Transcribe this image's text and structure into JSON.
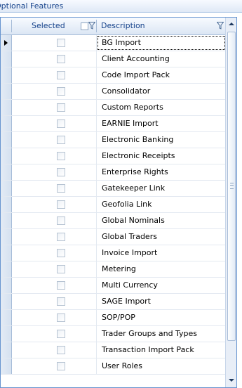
{
  "panel": {
    "title": "Optional Features"
  },
  "grid": {
    "columns": {
      "selected": "Selected",
      "description": "Description"
    },
    "current_row": 0,
    "rows": [
      {
        "description": "BG Import",
        "selected": false
      },
      {
        "description": "Client Accounting",
        "selected": false
      },
      {
        "description": "Code Import Pack",
        "selected": false
      },
      {
        "description": "Consolidator",
        "selected": false
      },
      {
        "description": "Custom Reports",
        "selected": false
      },
      {
        "description": "EARNIE Import",
        "selected": false
      },
      {
        "description": "Electronic Banking",
        "selected": false
      },
      {
        "description": "Electronic Receipts",
        "selected": false
      },
      {
        "description": "Enterprise Rights",
        "selected": false
      },
      {
        "description": "Gatekeeper Link",
        "selected": false
      },
      {
        "description": "Geofolia Link",
        "selected": false
      },
      {
        "description": "Global Nominals",
        "selected": false
      },
      {
        "description": "Global Traders",
        "selected": false
      },
      {
        "description": "Invoice Import",
        "selected": false
      },
      {
        "description": "Metering",
        "selected": false
      },
      {
        "description": "Multi Currency",
        "selected": false
      },
      {
        "description": "SAGE Import",
        "selected": false
      },
      {
        "description": "SOP/POP",
        "selected": false
      },
      {
        "description": "Trader Groups and Types",
        "selected": false
      },
      {
        "description": "Transaction Import Pack",
        "selected": false
      },
      {
        "description": "User Roles",
        "selected": false
      }
    ]
  },
  "icons": {
    "row_indicator": "current-row-arrow-icon",
    "filter": "filter-funnel-icon",
    "scroll_up": "scroll-up-arrow-icon",
    "scroll_down": "scroll-down-arrow-icon"
  },
  "colors": {
    "header_text": "#15428b",
    "border": "#6593cf"
  }
}
